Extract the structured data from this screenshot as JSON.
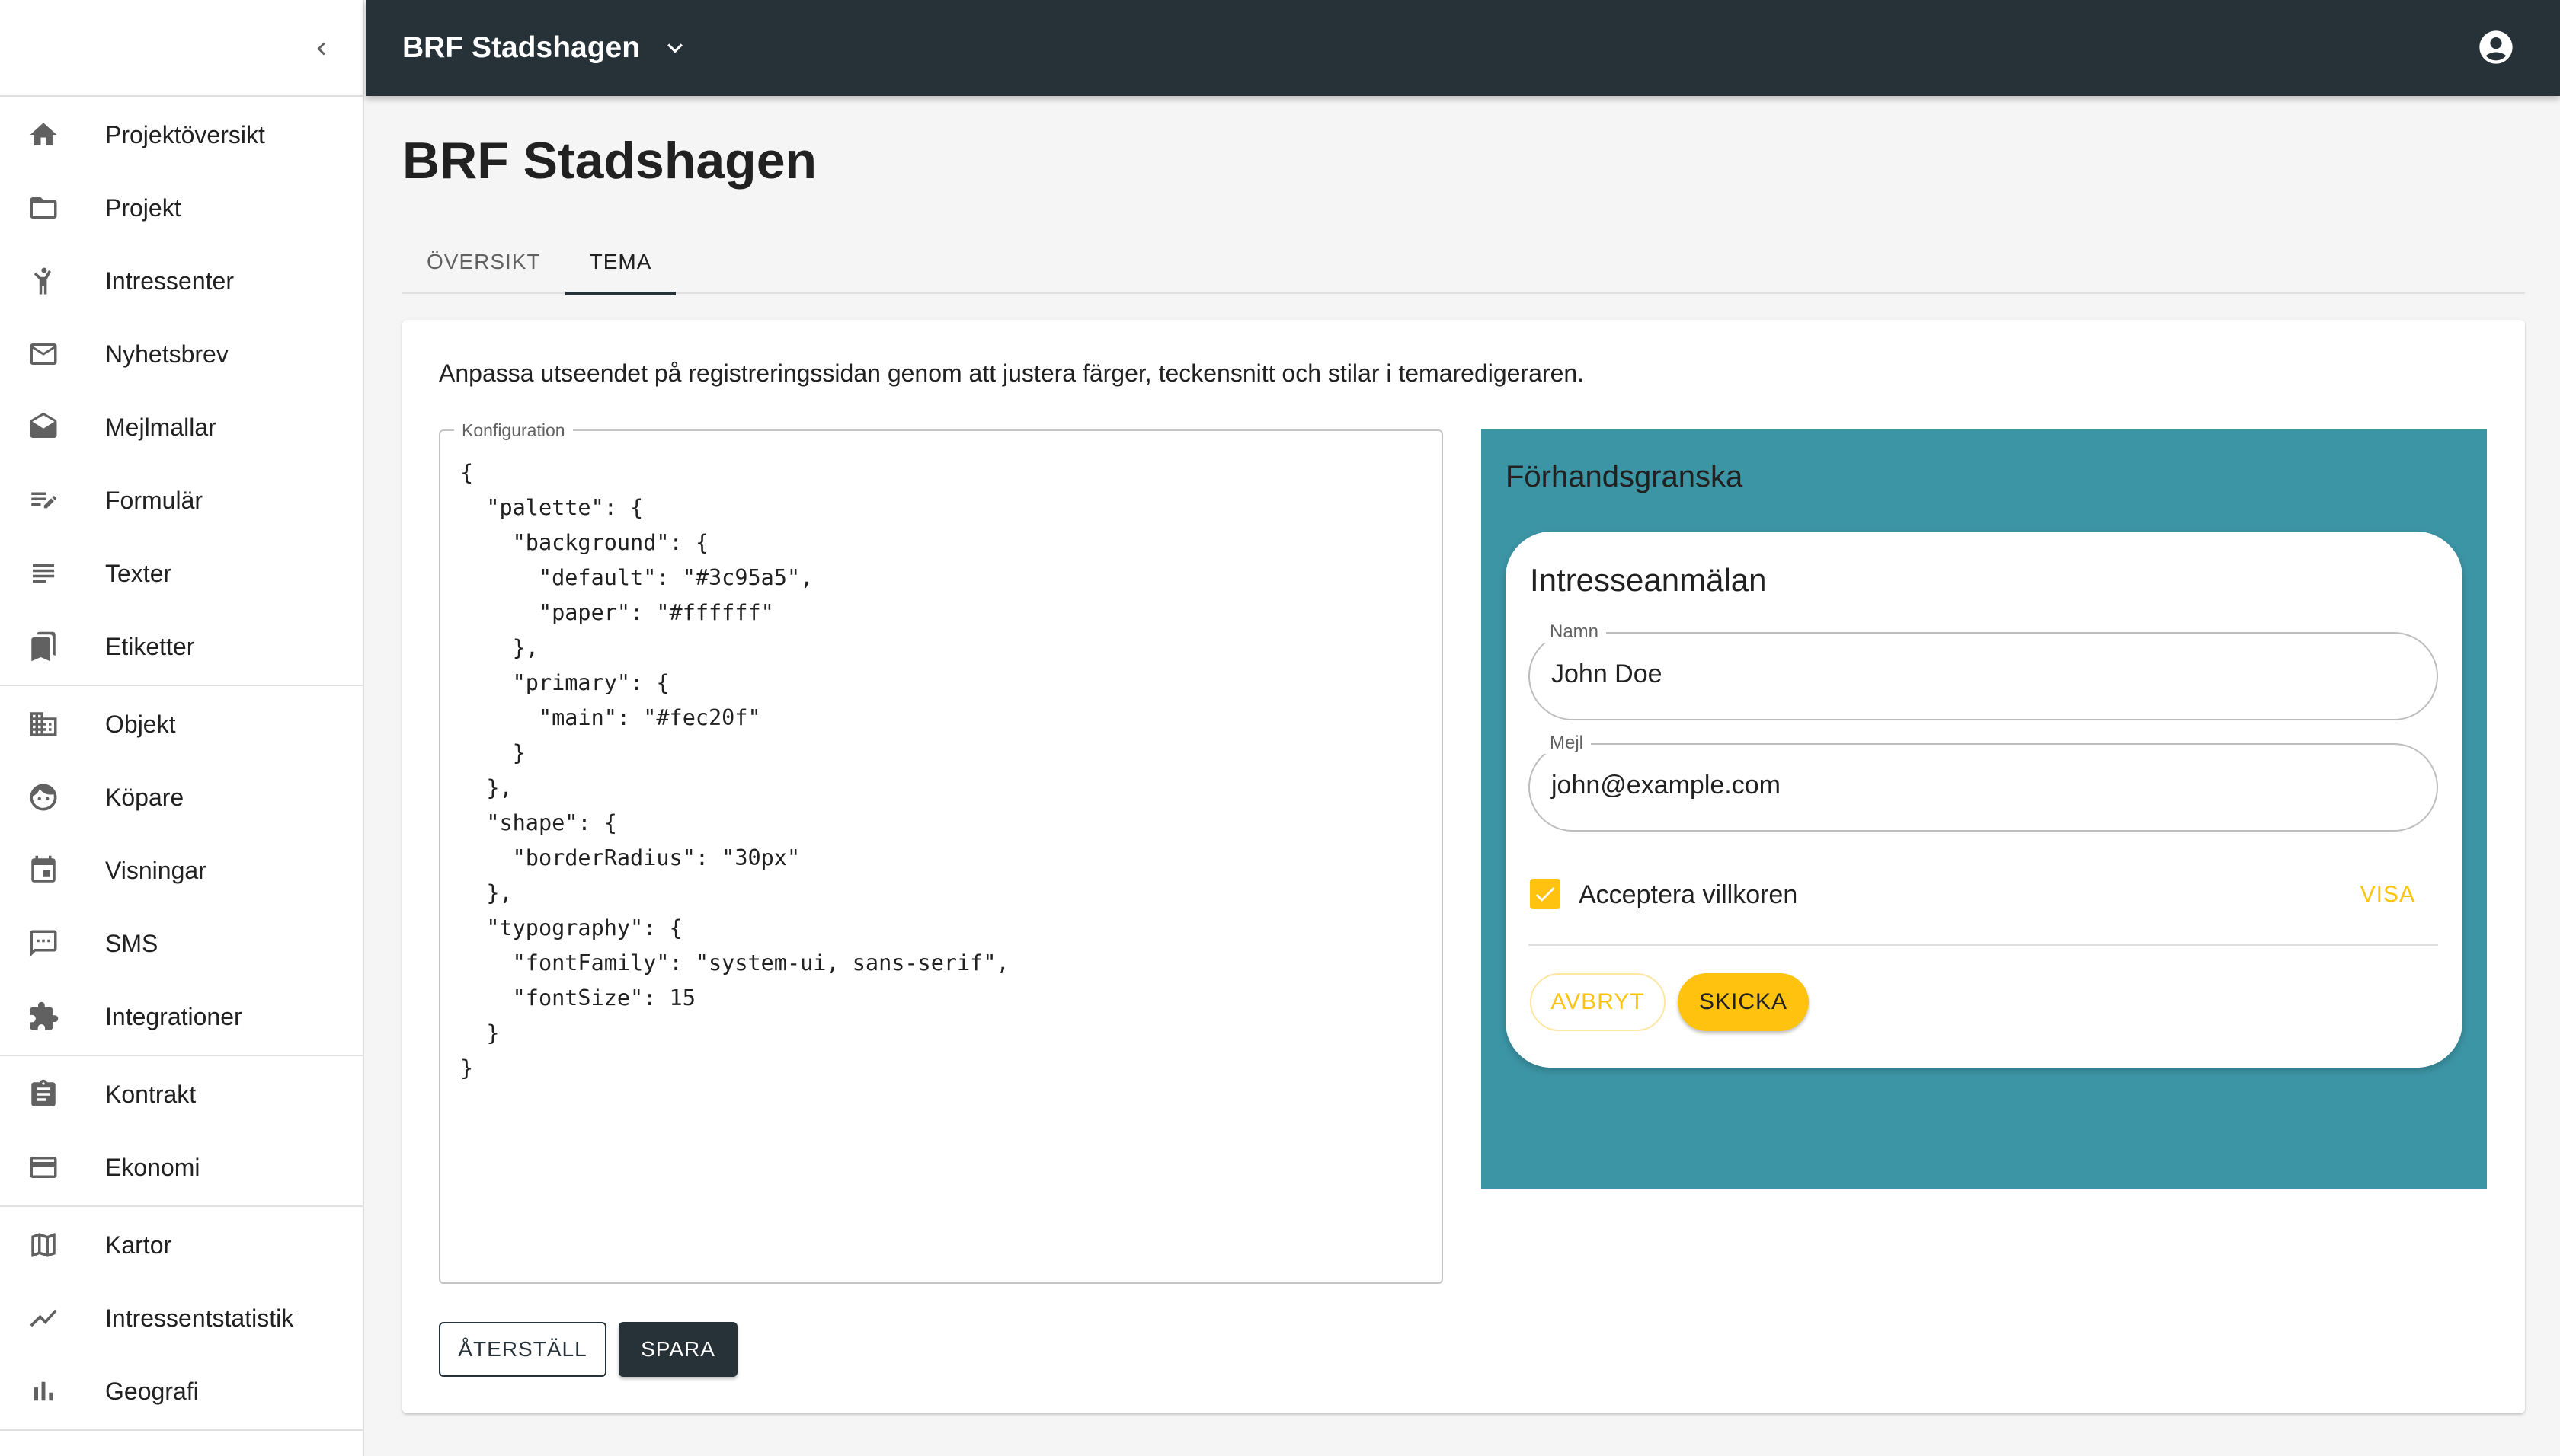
{
  "sidebar": {
    "collapse_icon": "chevron-left-icon",
    "groups": [
      [
        {
          "label": "Projektöversikt",
          "icon": "home-icon"
        },
        {
          "label": "Projekt",
          "icon": "folder-icon"
        },
        {
          "label": "Intressenter",
          "icon": "person-waving-icon"
        },
        {
          "label": "Nyhetsbrev",
          "icon": "mail-icon"
        },
        {
          "label": "Mejlmallar",
          "icon": "drafts-icon"
        },
        {
          "label": "Formulär",
          "icon": "edit-note-icon"
        },
        {
          "label": "Texter",
          "icon": "subject-icon"
        },
        {
          "label": "Etiketter",
          "icon": "bookmarks-icon"
        }
      ],
      [
        {
          "label": "Objekt",
          "icon": "building-icon"
        },
        {
          "label": "Köpare",
          "icon": "face-icon"
        },
        {
          "label": "Visningar",
          "icon": "calendar-icon"
        },
        {
          "label": "SMS",
          "icon": "sms-icon"
        },
        {
          "label": "Integrationer",
          "icon": "puzzle-icon"
        }
      ],
      [
        {
          "label": "Kontrakt",
          "icon": "assignment-icon"
        },
        {
          "label": "Ekonomi",
          "icon": "credit-card-icon"
        }
      ],
      [
        {
          "label": "Kartor",
          "icon": "map-icon"
        },
        {
          "label": "Intressentstatistik",
          "icon": "trend-icon"
        },
        {
          "label": "Geografi",
          "icon": "bar-chart-icon"
        }
      ]
    ]
  },
  "topbar": {
    "project_name": "BRF Stadshagen",
    "chevron_icon": "chevron-down-icon",
    "account_icon": "account-circle-icon"
  },
  "page": {
    "title": "BRF Stadshagen",
    "tabs": [
      {
        "label": "ÖVERSIKT",
        "active": false
      },
      {
        "label": "TEMA",
        "active": true
      }
    ]
  },
  "theme_editor": {
    "intro": "Anpassa utseendet på registreringssidan genom att justera färger, teckensnitt och stilar i temaredigeraren.",
    "config_label": "Konfiguration",
    "config_text": "{\n  \"palette\": {\n    \"background\": {\n      \"default\": \"#3c95a5\",\n      \"paper\": \"#ffffff\"\n    },\n    \"primary\": {\n      \"main\": \"#fec20f\"\n    }\n  },\n  \"shape\": {\n    \"borderRadius\": \"30px\"\n  },\n  \"typography\": {\n    \"fontFamily\": \"system-ui, sans-serif\",\n    \"fontSize\": 15\n  }\n}",
    "reset_label": "ÅTERSTÄLL",
    "save_label": "SPARA"
  },
  "preview": {
    "title": "Förhandsgranska",
    "form_title": "Intresseanmälan",
    "name_label": "Namn",
    "name_value": "John Doe",
    "email_label": "Mejl",
    "email_value": "john@example.com",
    "terms_label": "Acceptera villkoren",
    "terms_checked": true,
    "view_terms_label": "VISA",
    "cancel_label": "AVBRYT",
    "submit_label": "SKICKA"
  },
  "colors": {
    "topbar": "#263238",
    "preview_background": "#3c95a5",
    "preview_paper": "#ffffff",
    "primary": "#fec20f"
  }
}
